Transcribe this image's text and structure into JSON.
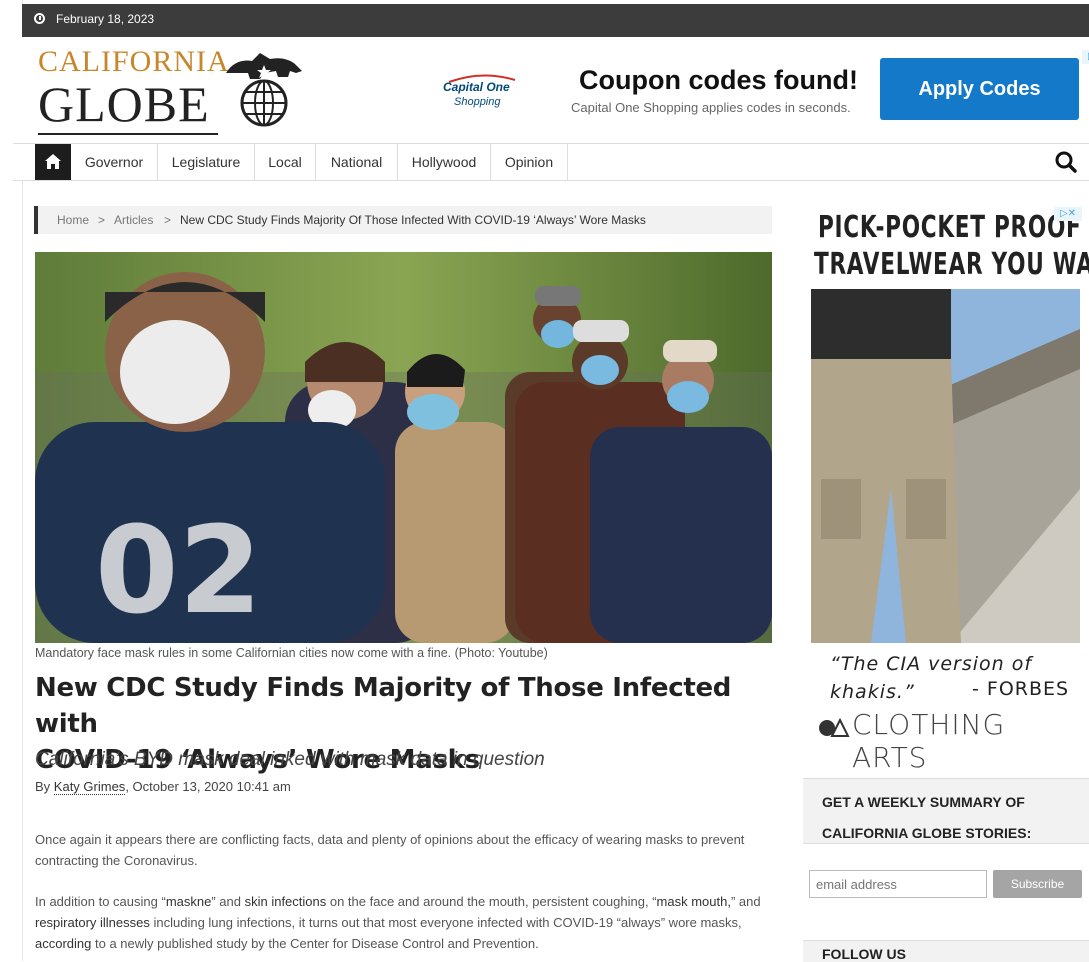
{
  "topbar": {
    "date": "February 18, 2023"
  },
  "logo": {
    "line1": "CALIFORNIA",
    "line2": "GLOBE"
  },
  "top_ad": {
    "brand_line1": "Capital One",
    "brand_line2": "Shopping",
    "headline": "Coupon codes found!",
    "subtext": "Capital One Shopping applies codes in seconds.",
    "button": "Apply Codes"
  },
  "nav": {
    "items": [
      "Governor",
      "Legislature",
      "Local",
      "National",
      "Hollywood",
      "Opinion"
    ]
  },
  "breadcrumb": {
    "home": "Home",
    "sep": ">",
    "articles": "Articles",
    "current": "New CDC Study Finds Majority Of Those Infected With COVID-19 ‘Always’ Wore Masks"
  },
  "article": {
    "caption": "Mandatory face mask rules in some Californian cities now come with a fine. (Photo: Youtube)",
    "title_line1": "New CDC Study Finds Majority of Those Infected with",
    "title_line2": "COVID-19 ‘Always’ Wore Masks",
    "subtitle": "California’s BYD mask deal inked with mask data in question",
    "by": "By",
    "author": "Katy Grimes",
    "date": ", October 13, 2020 10:41 am",
    "para1": "Once again it appears there are conflicting facts, data and plenty of opinions about the efficacy of wearing masks to prevent contracting the Coronavirus.",
    "para2_a": "In addition to causing “",
    "para2_maskne": "maskne",
    "para2_b": "” and ",
    "para2_skin": "skin infections",
    "para2_c": " on the face and around the mouth, persistent coughing, “",
    "para2_mouth": "mask mouth,",
    "para2_d": "” and ",
    "para2_resp": "respiratory illnesses",
    "para2_e": " including lung infections, it turns out that most everyone infected with COVID-19 “always” wore masks, ",
    "para2_acc": "according",
    "para2_f": " to a newly published study by the Center for Disease Control and Prevention."
  },
  "side_ad": {
    "headline1": "PICK-POCKET PROOF",
    "headline2": "TRAVELWEAR YOU WANT",
    "quote1": "“The CIA version of",
    "quote2": "khakis.”",
    "forbes": "- FORBES",
    "brand": "CLOTHING ARTS"
  },
  "newsletter": {
    "line1": "GET A WEEKLY SUMMARY OF",
    "line2": "CALIFORNIA GLOBE STORIES:",
    "email_placeholder": "email address",
    "subscribe": "Subscribe"
  },
  "follow": {
    "title": "FOLLOW US"
  }
}
